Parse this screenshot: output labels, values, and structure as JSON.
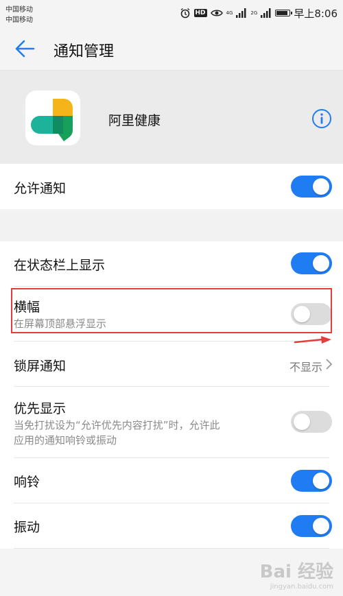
{
  "status_bar": {
    "carrier_1": "中国移动",
    "carrier_2": "中国移动",
    "hd": "HD",
    "net_1": "4G",
    "net_2": "2G",
    "time": "早上8:06",
    "battery_level": 0.8
  },
  "app_bar": {
    "title": "通知管理"
  },
  "app": {
    "name": "阿里健康"
  },
  "settings": {
    "allow_notifications": {
      "label": "允许通知",
      "enabled": true
    },
    "status_bar_display": {
      "label": "在状态栏上显示",
      "enabled": true
    },
    "banner": {
      "label": "横幅",
      "subtitle": "在屏幕顶部悬浮显示",
      "enabled": false
    },
    "lock_screen": {
      "label": "锁屏通知",
      "value": "不显示"
    },
    "priority": {
      "label": "优先显示",
      "subtitle_line1": "当免打扰设为“允许优先内容打扰”时，允许此",
      "subtitle_line2": "应用的通知响铃或振动",
      "enabled": false
    },
    "ringtone": {
      "label": "响铃",
      "enabled": true
    },
    "vibrate": {
      "label": "振动",
      "enabled": true
    }
  },
  "watermark": {
    "main": "Bai 经验",
    "sub": "jingyan.baidu.com"
  },
  "colors": {
    "accent": "#1f7cf2",
    "toggle_off": "#dcdcdc",
    "highlight": "#e53b3b"
  }
}
